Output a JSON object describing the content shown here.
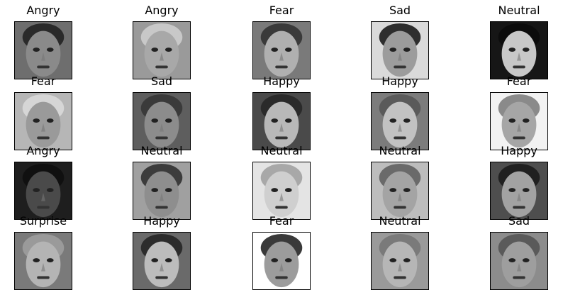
{
  "tiles": [
    {
      "label": "Angry",
      "bg": "#6e6e6e",
      "skin": "#8a8a8a",
      "hair": "#2a2a2a"
    },
    {
      "label": "Angry",
      "bg": "#9a9a9a",
      "skin": "#a8a8a8",
      "hair": "#c8c8c8"
    },
    {
      "label": "Fear",
      "bg": "#7a7a7a",
      "skin": "#b0b0b0",
      "hair": "#3a3a3a"
    },
    {
      "label": "Sad",
      "bg": "#dadada",
      "skin": "#9c9c9c",
      "hair": "#2e2e2e"
    },
    {
      "label": "Neutral",
      "bg": "#161616",
      "skin": "#c8c8c8",
      "hair": "#0c0c0c"
    },
    {
      "label": "Fear",
      "bg": "#b6b6b6",
      "skin": "#9a9a9a",
      "hair": "#d6d6d6"
    },
    {
      "label": "Sad",
      "bg": "#5e5e5e",
      "skin": "#8c8c8c",
      "hair": "#3a3a3a"
    },
    {
      "label": "Happy",
      "bg": "#4a4a4a",
      "skin": "#b8b8b8",
      "hair": "#2a2a2a"
    },
    {
      "label": "Happy",
      "bg": "#7c7c7c",
      "skin": "#c2c2c2",
      "hair": "#5a5a5a"
    },
    {
      "label": "Fear",
      "bg": "#f2f2f2",
      "skin": "#a6a6a6",
      "hair": "#8a8a8a"
    },
    {
      "label": "Angry",
      "bg": "#1e1e1e",
      "skin": "#4a4a4a",
      "hair": "#101010"
    },
    {
      "label": "Neutral",
      "bg": "#a0a0a0",
      "skin": "#8e8e8e",
      "hair": "#3c3c3c"
    },
    {
      "label": "Neutral",
      "bg": "#e4e4e4",
      "skin": "#cfcfcf",
      "hair": "#a8a8a8"
    },
    {
      "label": "Neutral",
      "bg": "#bdbdbd",
      "skin": "#a4a4a4",
      "hair": "#6a6a6a"
    },
    {
      "label": "Happy",
      "bg": "#4e4e4e",
      "skin": "#a2a2a2",
      "hair": "#202020"
    },
    {
      "label": "Surprise",
      "bg": "#7a7a7a",
      "skin": "#b4b4b4",
      "hair": "#9a9a9a"
    },
    {
      "label": "Happy",
      "bg": "#6a6a6a",
      "skin": "#bcbcbc",
      "hair": "#2c2c2c"
    },
    {
      "label": "Fear",
      "bg": "#ffffff",
      "skin": "#9c9c9c",
      "hair": "#3a3a3a"
    },
    {
      "label": "Neutral",
      "bg": "#9a9a9a",
      "skin": "#b6b6b6",
      "hair": "#7a7a7a"
    },
    {
      "label": "Sad",
      "bg": "#8c8c8c",
      "skin": "#9e9e9e",
      "hair": "#5a5a5a"
    }
  ]
}
